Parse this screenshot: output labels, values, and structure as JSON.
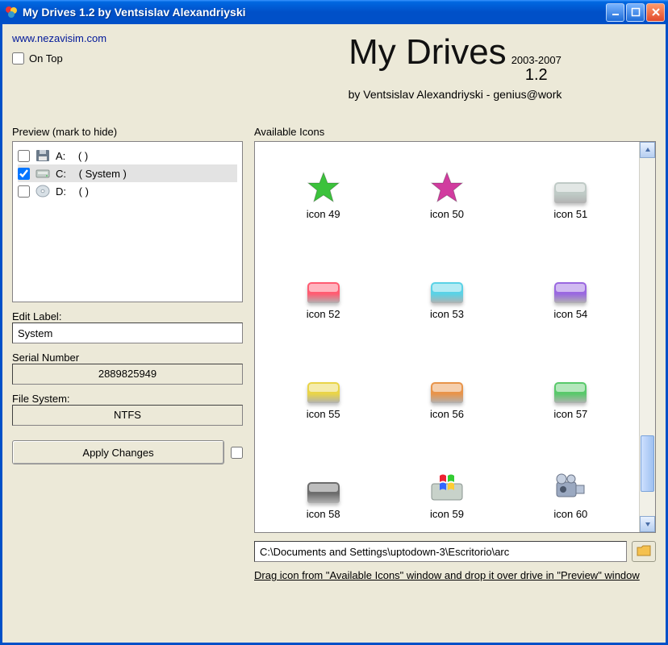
{
  "title": "My Drives 1.2 by Ventsislav Alexandriyski",
  "link": "www.nezavisim.com",
  "on_top_label": "On Top",
  "logo": {
    "name": "My Drives",
    "years": "2003-2007",
    "version": "1.2",
    "author": "by Ventsislav Alexandriyski - genius@work"
  },
  "preview_label": "Preview (mark to hide)",
  "drives": [
    {
      "letter": "A:",
      "label": "( )",
      "checked": false,
      "selected": false
    },
    {
      "letter": "C:",
      "label": "( System )",
      "checked": true,
      "selected": true
    },
    {
      "letter": "D:",
      "label": "( )",
      "checked": false,
      "selected": false
    }
  ],
  "edit_label_label": "Edit Label:",
  "edit_label_value": "System",
  "serial_label": "Serial Number",
  "serial_value": "2889825949",
  "fs_label": "File System:",
  "fs_value": "NTFS",
  "apply_label": "Apply Changes",
  "available_label": "Available Icons",
  "icons": [
    {
      "label": "icon 49",
      "color": "#3cc23c",
      "shape": "star"
    },
    {
      "label": "icon 50",
      "color": "#d13c9f",
      "shape": "star"
    },
    {
      "label": "icon 51",
      "color": "#bfcac6",
      "shape": "drive"
    },
    {
      "label": "icon 52",
      "color": "#ff5c72",
      "shape": "drive"
    },
    {
      "label": "icon 53",
      "color": "#5ad2e6",
      "shape": "drive"
    },
    {
      "label": "icon 54",
      "color": "#9a68e0",
      "shape": "drive"
    },
    {
      "label": "icon 55",
      "color": "#e9d448",
      "shape": "drive"
    },
    {
      "label": "icon 56",
      "color": "#e8944a",
      "shape": "drive"
    },
    {
      "label": "icon 57",
      "color": "#59c96b",
      "shape": "drive"
    },
    {
      "label": "icon 58",
      "color": "#6d6d6d",
      "shape": "drive"
    },
    {
      "label": "icon 59",
      "color": "#b4c8bc",
      "shape": "winlogo"
    },
    {
      "label": "icon 60",
      "color": "#9aa8c0",
      "shape": "camcorder"
    }
  ],
  "path_value": "C:\\Documents and Settings\\uptodown-3\\Escritorio\\arc",
  "hint": "Drag icon from \"Available Icons\" window and drop it over drive in \"Preview\" window"
}
